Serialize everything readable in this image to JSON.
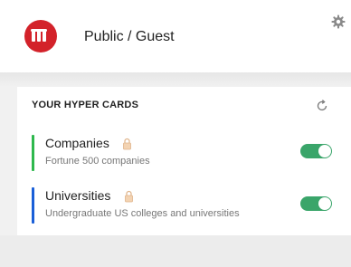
{
  "header": {
    "account_name": "Public / Guest",
    "logo_color": "#d3222a",
    "logo_icon": "hyper-logo",
    "settings_icon": "gear-icon"
  },
  "section": {
    "title": "YOUR HYPER CARDS",
    "refresh_icon": "refresh-icon"
  },
  "cards": [
    {
      "name": "Companies",
      "description": "Fortune 500 companies",
      "accent_color": "#2eb84d",
      "lock_icon": "lock-icon",
      "enabled": true
    },
    {
      "name": "Universities",
      "description": "Undergraduate US colleges and universities",
      "accent_color": "#1a5fd8",
      "lock_icon": "lock-icon",
      "enabled": true
    }
  ],
  "colors": {
    "toggle_on": "#3aa56a",
    "background": "#f1f1f1"
  }
}
